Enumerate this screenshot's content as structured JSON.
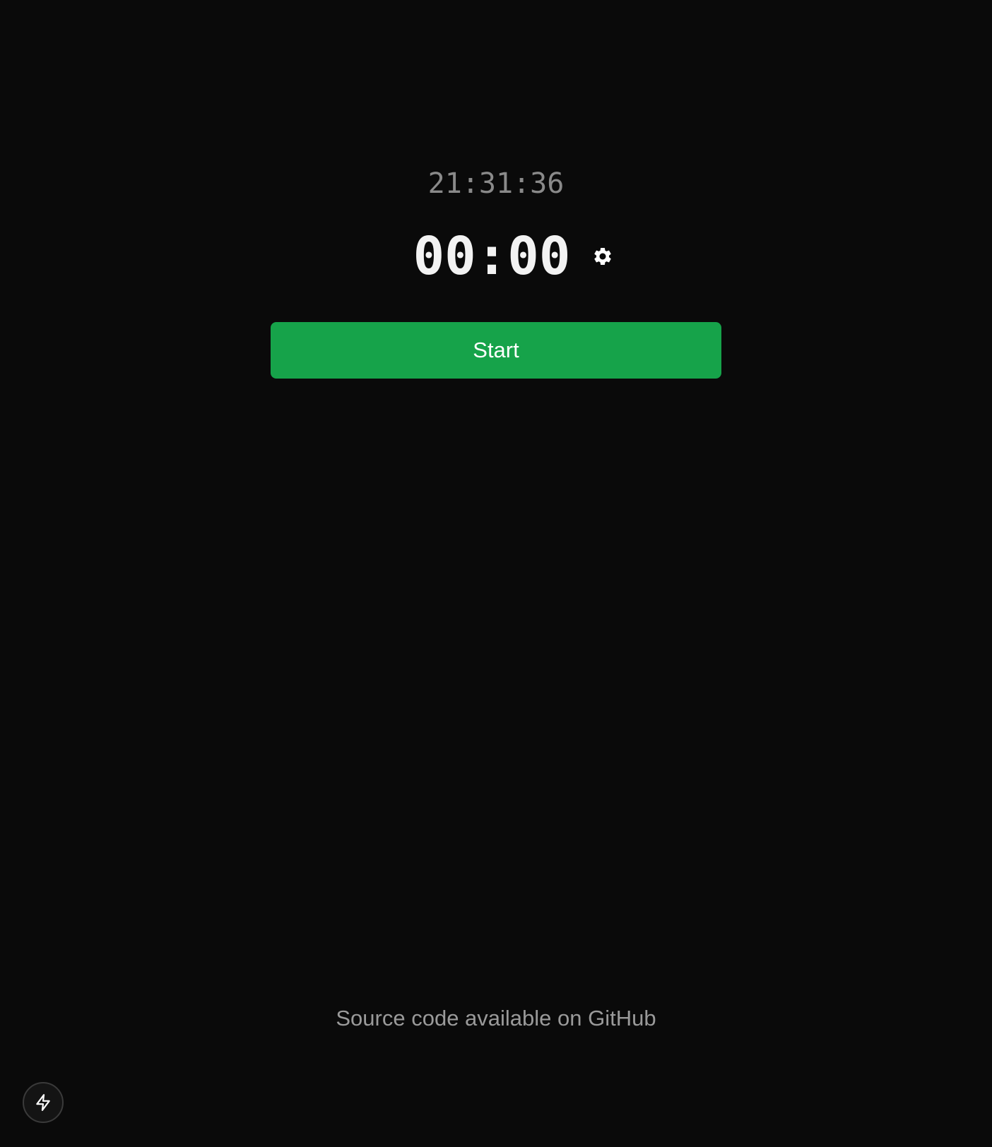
{
  "clock": {
    "time": "21:31:36"
  },
  "timer": {
    "display": "00:00",
    "settings_icon": "gear-icon"
  },
  "controls": {
    "start_label": "Start",
    "start_color": "#16a34a"
  },
  "footer": {
    "text": "Source code available on GitHub"
  },
  "floating": {
    "icon": "lightning-bolt-icon"
  },
  "colors": {
    "background": "#0a0a0a",
    "clock_text": "#8a8a8a",
    "timer_text": "#f2f2f2",
    "footer_text": "#9a9a9a"
  }
}
